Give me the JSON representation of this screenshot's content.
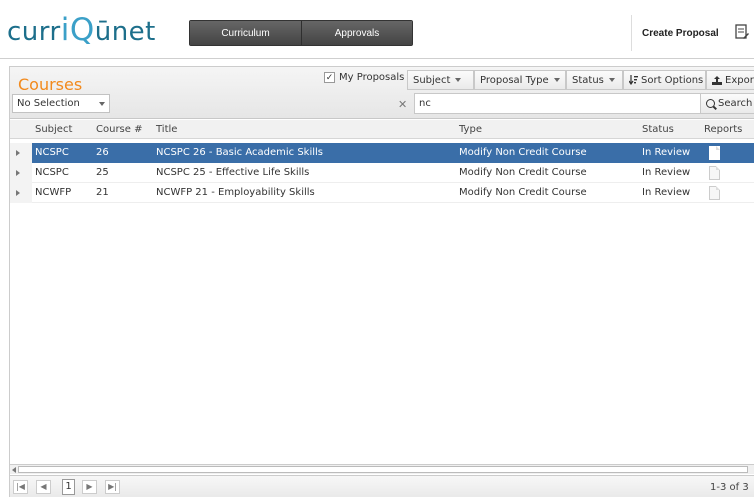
{
  "header": {
    "logo_part1": "curr",
    "logo_q": "iQ",
    "logo_part2": "ūnet",
    "nav": [
      "Curriculum",
      "Approvals"
    ],
    "create_label": "Create Proposal",
    "create_icon": "document-edit-icon"
  },
  "toolbar": {
    "title": "Courses",
    "selection": "No Selection",
    "my_proposals": "My Proposals",
    "my_proposals_checked": true,
    "subject": "Subject",
    "proposal_type": "Proposal Type",
    "status": "Status",
    "sort_options": "Sort Options",
    "export": "Expor",
    "search_value": "nc",
    "search_label": "Search"
  },
  "table": {
    "headers": [
      "Subject",
      "Course #",
      "Title",
      "Type",
      "Status",
      "Reports"
    ],
    "rows": [
      {
        "subject": "NCSPC",
        "course": "26",
        "title": "NCSPC 26 - Basic Academic Skills",
        "type": "Modify Non Credit Course",
        "status": "In Review",
        "selected": true
      },
      {
        "subject": "NCSPC",
        "course": "25",
        "title": "NCSPC 25 - Effective Life Skills",
        "type": "Modify Non Credit Course",
        "status": "In Review",
        "selected": false
      },
      {
        "subject": "NCWFP",
        "course": "21",
        "title": "NCWFP 21 - Employability Skills",
        "type": "Modify Non Credit Course",
        "status": "In Review",
        "selected": false
      }
    ]
  },
  "pager": {
    "page": "1",
    "range": "1-3 of 3"
  },
  "colors": {
    "brand": "#1d6f8b",
    "accent": "#f28a1d",
    "selected_row": "#3a6ea8"
  }
}
